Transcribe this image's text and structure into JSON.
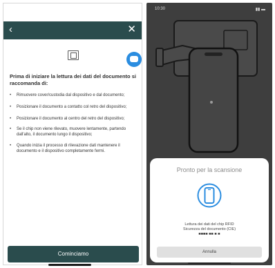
{
  "left": {
    "nav": {
      "back_icon": "‹",
      "close_icon": "✕"
    },
    "intro": "Prima di iniziare la lettura dei dati del documento si raccomanda di:",
    "steps": [
      "Rimuovere cover/custodia dal dispositivo e dal documento;",
      "Posizionare il documento a contatto col retro del dispositivo;",
      "Posizionare il documento al centro del retro del dispositivo;",
      "Se il chip non viene rilevato, muovere lentamente, partendo dall'alto, il documento lungo il dispositivo;",
      "Quando inizia il processo di rilevazione dati mantenere il documento e il dispositivo completamente fermi."
    ],
    "bullet": "•",
    "start_button": "Cominciamo"
  },
  "right": {
    "status": {
      "time": "10:30",
      "signals": "▮▮ ▬"
    },
    "sheet": {
      "title": "Pronto per la scansione",
      "reading_line1": "Lettura dei dati del chip RFID",
      "reading_line2": "Sicurezza del documento (CIE)",
      "reading_line3": "■■■■ ■■ ■ ■",
      "cancel": "Annulla"
    }
  },
  "colors": {
    "nav": "#2a4c4d",
    "accent": "#2b8de0",
    "dark_bg": "#3e3e3e"
  },
  "icons": {
    "doc": "document-icon",
    "chat": "chat-icon",
    "phone": "phone-icon"
  }
}
